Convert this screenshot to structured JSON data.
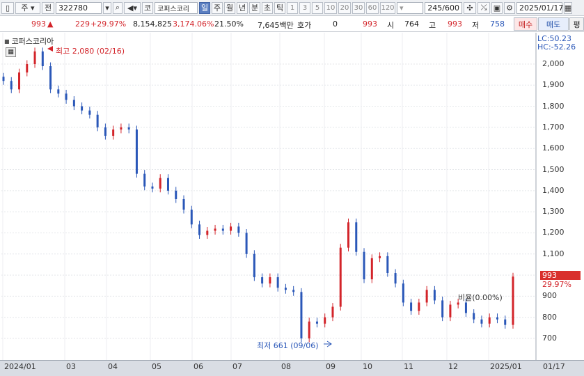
{
  "toolbar": {
    "type_label": "주",
    "prev_label": "전",
    "code_value": "322780",
    "market_label": "코",
    "stock_name": "코퍼스코리",
    "periods": [
      "일",
      "주",
      "월",
      "년",
      "분",
      "초",
      "틱"
    ],
    "intervals": [
      "1",
      "3",
      "5",
      "10",
      "20",
      "30",
      "60",
      "120"
    ],
    "count": "245/600",
    "date": "2025/01/17"
  },
  "quote": {
    "price": "993",
    "change": "229",
    "change_pct": "+29.97%",
    "volume": "8,154,825",
    "volume_pct": "3,174.06%",
    "turnover_pct": "21.50%",
    "amount": "7,645백만",
    "hoga_label": "호가",
    "hoga_value": "0",
    "hoga_price": "993",
    "open_label": "시",
    "open_value": "764",
    "high_label": "고",
    "high_value": "993",
    "low_label": "저",
    "low_value": "758",
    "buy_label": "매수",
    "sell_label": "매도",
    "avg_label": "평"
  },
  "chart_header": {
    "title": "코퍼스코리아",
    "lc": "LC:50.23",
    "hc": "HC:-52.26"
  },
  "annotations": {
    "high": "최고 2,080 (02/16)",
    "low": "최저 661 (09/06)",
    "ratio": "비율(0.00%)",
    "last_price": "993",
    "last_pct": "29.97%"
  },
  "chart_data": {
    "type": "candlestick",
    "y_ticks": [
      "2,000",
      "1,900",
      "1,800",
      "1,700",
      "1,600",
      "1,500",
      "1,400",
      "1,300",
      "1,200",
      "1,100",
      "1,000",
      "900",
      "800",
      "700"
    ],
    "x_ticks": [
      "2024/01",
      "03",
      "04",
      "05",
      "06",
      "07",
      "08",
      "09",
      "10",
      "11",
      "12",
      "2025/01",
      "01/17"
    ],
    "ylim": [
      640,
      2110
    ],
    "series": [
      {
        "x": "2024/01",
        "close": 1920
      },
      {
        "x": "2024/01",
        "close": 1880
      },
      {
        "x": "2024/02",
        "close": 1960
      },
      {
        "x": "2024/02",
        "close": 2000
      },
      {
        "x": "2024/02",
        "close": 2060
      },
      {
        "x": "2024/02",
        "close": 1990
      },
      {
        "x": "2024/03",
        "close": 1880
      },
      {
        "x": "2024/03",
        "close": 1860
      },
      {
        "x": "2024/03",
        "close": 1830
      },
      {
        "x": "2024/04",
        "close": 1800
      },
      {
        "x": "2024/04",
        "close": 1780
      },
      {
        "x": "2024/04",
        "close": 1760
      },
      {
        "x": "2024/04",
        "close": 1700
      },
      {
        "x": "2024/05",
        "close": 1660
      },
      {
        "x": "2024/05",
        "close": 1690
      },
      {
        "x": "2024/05",
        "close": 1700
      },
      {
        "x": "2024/05",
        "close": 1690
      },
      {
        "x": "2024/05",
        "close": 1480
      },
      {
        "x": "2024/06",
        "close": 1420
      },
      {
        "x": "2024/06",
        "close": 1410
      },
      {
        "x": "2024/06",
        "close": 1460
      },
      {
        "x": "2024/06",
        "close": 1400
      },
      {
        "x": "2024/07",
        "close": 1360
      },
      {
        "x": "2024/07",
        "close": 1310
      },
      {
        "x": "2024/07",
        "close": 1240
      },
      {
        "x": "2024/07",
        "close": 1190
      },
      {
        "x": "2024/07",
        "close": 1210
      },
      {
        "x": "2024/07",
        "close": 1220
      },
      {
        "x": "2024/07",
        "close": 1210
      },
      {
        "x": "2024/08",
        "close": 1230
      },
      {
        "x": "2024/08",
        "close": 1200
      },
      {
        "x": "2024/08",
        "close": 1100
      },
      {
        "x": "2024/08",
        "close": 990
      },
      {
        "x": "2024/08",
        "close": 960
      },
      {
        "x": "2024/08",
        "close": 990
      },
      {
        "x": "2024/08",
        "close": 940
      },
      {
        "x": "2024/09",
        "close": 930
      },
      {
        "x": "2024/09",
        "close": 920
      },
      {
        "x": "2024/09",
        "close": 700
      },
      {
        "x": "2024/09",
        "close": 780
      },
      {
        "x": "2024/09",
        "close": 770
      },
      {
        "x": "2024/09",
        "close": 800
      },
      {
        "x": "2024/10",
        "close": 850
      },
      {
        "x": "2024/10",
        "close": 1130
      },
      {
        "x": "2024/10",
        "close": 1250
      },
      {
        "x": "2024/10",
        "close": 1110
      },
      {
        "x": "2024/10",
        "close": 980
      },
      {
        "x": "2024/10",
        "close": 1080
      },
      {
        "x": "2024/10",
        "close": 1090
      },
      {
        "x": "2024/11",
        "close": 1010
      },
      {
        "x": "2024/11",
        "close": 960
      },
      {
        "x": "2024/11",
        "close": 870
      },
      {
        "x": "2024/11",
        "close": 830
      },
      {
        "x": "2024/11",
        "close": 870
      },
      {
        "x": "2024/12",
        "close": 930
      },
      {
        "x": "2024/12",
        "close": 880
      },
      {
        "x": "2024/12",
        "close": 800
      },
      {
        "x": "2024/12",
        "close": 860
      },
      {
        "x": "2024/12",
        "close": 870
      },
      {
        "x": "2024/12",
        "close": 820
      },
      {
        "x": "2025/01",
        "close": 790
      },
      {
        "x": "2025/01",
        "close": 770
      },
      {
        "x": "2025/01",
        "close": 800
      },
      {
        "x": "2025/01",
        "close": 790
      },
      {
        "x": "2025/01",
        "close": 764
      },
      {
        "x": "2025/01/17",
        "close": 993
      }
    ]
  }
}
